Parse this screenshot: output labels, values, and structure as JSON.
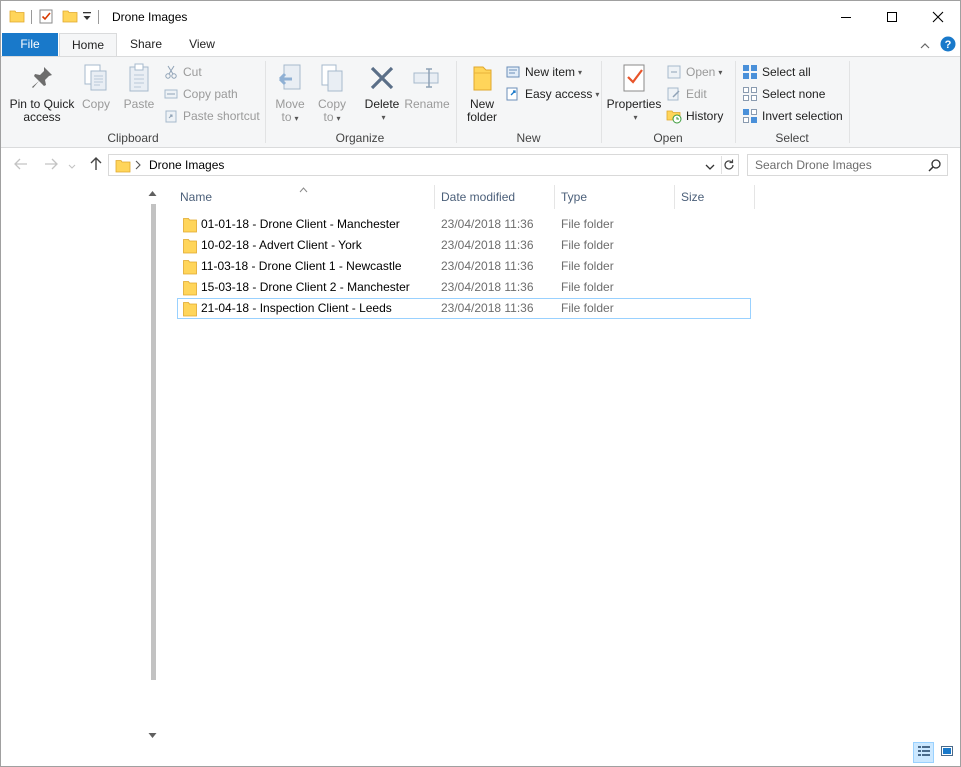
{
  "window": {
    "title": "Drone Images"
  },
  "tabs": {
    "file": "File",
    "home": "Home",
    "share": "Share",
    "view": "View"
  },
  "ribbon": {
    "clipboard": {
      "label": "Clipboard",
      "pin_line1": "Pin to Quick",
      "pin_line2": "access",
      "copy": "Copy",
      "paste": "Paste",
      "cut": "Cut",
      "copy_path": "Copy path",
      "paste_shortcut": "Paste shortcut"
    },
    "organize": {
      "label": "Organize",
      "move_line1": "Move",
      "move_line2": "to",
      "copy_line1": "Copy",
      "copy_line2": "to",
      "delete": "Delete",
      "rename": "Rename"
    },
    "new": {
      "label": "New",
      "new_folder_line1": "New",
      "new_folder_line2": "folder",
      "new_item": "New item",
      "easy_access": "Easy access"
    },
    "open": {
      "label": "Open",
      "properties": "Properties",
      "open": "Open",
      "edit": "Edit",
      "history": "History"
    },
    "select": {
      "label": "Select",
      "select_all": "Select all",
      "select_none": "Select none",
      "invert": "Invert selection"
    }
  },
  "address": {
    "path": "Drone Images"
  },
  "search": {
    "placeholder": "Search Drone Images"
  },
  "columns": {
    "name": "Name",
    "date": "Date modified",
    "type": "Type",
    "size": "Size"
  },
  "files": [
    {
      "name": "01-01-18 - Drone Client - Manchester",
      "date": "23/04/2018 11:36",
      "type": "File folder",
      "selected": false
    },
    {
      "name": "10-02-18 - Advert Client - York",
      "date": "23/04/2018 11:36",
      "type": "File folder",
      "selected": false
    },
    {
      "name": "11-03-18 - Drone Client 1 - Newcastle",
      "date": "23/04/2018 11:36",
      "type": "File folder",
      "selected": false
    },
    {
      "name": "15-03-18 - Drone Client 2 - Manchester",
      "date": "23/04/2018 11:36",
      "type": "File folder",
      "selected": false
    },
    {
      "name": "21-04-18 - Inspection Client - Leeds",
      "date": "23/04/2018 11:36",
      "type": "File folder",
      "selected": true
    }
  ],
  "colors": {
    "accent": "#1979ca",
    "folder": "#ffd55a",
    "selection_border": "#99d1ff",
    "header_text": "#4c607a"
  },
  "icons": {
    "folder": "folder-icon",
    "pin": "pin-icon",
    "copy": "copy-icon",
    "paste": "paste-icon",
    "cut": "scissors-icon",
    "delete": "x-icon",
    "help": "help-icon",
    "search": "magnifier-icon"
  }
}
